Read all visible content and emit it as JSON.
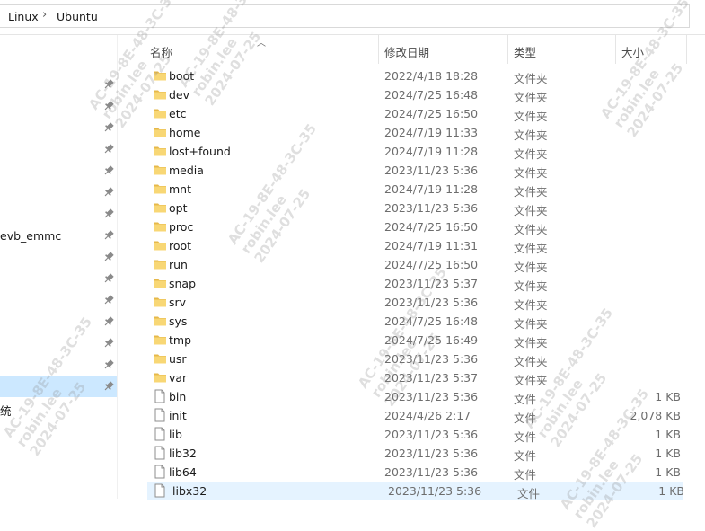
{
  "breadcrumb": {
    "items": [
      "Linux",
      "Ubuntu"
    ],
    "separator": "›"
  },
  "nav": {
    "items": [
      {
        "label": "evb_emmc"
      },
      {
        "label": "统"
      }
    ]
  },
  "columns": {
    "name": "名称",
    "date": "修改日期",
    "type": "类型",
    "size": "大小"
  },
  "files": [
    {
      "name": "boot",
      "date": "2022/4/18 18:28",
      "type": "文件夹",
      "size": "",
      "kind": "folder"
    },
    {
      "name": "dev",
      "date": "2024/7/25 16:48",
      "type": "文件夹",
      "size": "",
      "kind": "folder"
    },
    {
      "name": "etc",
      "date": "2024/7/25 16:50",
      "type": "文件夹",
      "size": "",
      "kind": "folder"
    },
    {
      "name": "home",
      "date": "2024/7/19 11:33",
      "type": "文件夹",
      "size": "",
      "kind": "folder"
    },
    {
      "name": "lost+found",
      "date": "2024/7/19 11:28",
      "type": "文件夹",
      "size": "",
      "kind": "folder"
    },
    {
      "name": "media",
      "date": "2023/11/23 5:36",
      "type": "文件夹",
      "size": "",
      "kind": "folder"
    },
    {
      "name": "mnt",
      "date": "2024/7/19 11:28",
      "type": "文件夹",
      "size": "",
      "kind": "folder"
    },
    {
      "name": "opt",
      "date": "2023/11/23 5:36",
      "type": "文件夹",
      "size": "",
      "kind": "folder"
    },
    {
      "name": "proc",
      "date": "2024/7/25 16:50",
      "type": "文件夹",
      "size": "",
      "kind": "folder"
    },
    {
      "name": "root",
      "date": "2024/7/19 11:31",
      "type": "文件夹",
      "size": "",
      "kind": "folder"
    },
    {
      "name": "run",
      "date": "2024/7/25 16:50",
      "type": "文件夹",
      "size": "",
      "kind": "folder"
    },
    {
      "name": "snap",
      "date": "2023/11/23 5:37",
      "type": "文件夹",
      "size": "",
      "kind": "folder"
    },
    {
      "name": "srv",
      "date": "2023/11/23 5:36",
      "type": "文件夹",
      "size": "",
      "kind": "folder"
    },
    {
      "name": "sys",
      "date": "2024/7/25 16:48",
      "type": "文件夹",
      "size": "",
      "kind": "folder"
    },
    {
      "name": "tmp",
      "date": "2024/7/25 16:49",
      "type": "文件夹",
      "size": "",
      "kind": "folder"
    },
    {
      "name": "usr",
      "date": "2023/11/23 5:36",
      "type": "文件夹",
      "size": "",
      "kind": "folder"
    },
    {
      "name": "var",
      "date": "2023/11/23 5:37",
      "type": "文件夹",
      "size": "",
      "kind": "folder"
    },
    {
      "name": "bin",
      "date": "2023/11/23 5:36",
      "type": "文件",
      "size": "1 KB",
      "kind": "file"
    },
    {
      "name": "init",
      "date": "2024/4/26 2:17",
      "type": "文件",
      "size": "2,078 KB",
      "kind": "file"
    },
    {
      "name": "lib",
      "date": "2023/11/23 5:36",
      "type": "文件",
      "size": "1 KB",
      "kind": "file"
    },
    {
      "name": "lib32",
      "date": "2023/11/23 5:36",
      "type": "文件",
      "size": "1 KB",
      "kind": "file"
    },
    {
      "name": "lib64",
      "date": "2023/11/23 5:36",
      "type": "文件",
      "size": "1 KB",
      "kind": "file"
    },
    {
      "name": "libx32",
      "date": "2023/11/23 5:36",
      "type": "文件",
      "size": "1 KB",
      "kind": "file",
      "selected": true
    }
  ],
  "watermark": {
    "lines": [
      "AC-19-8E-48-3C-35",
      "robin.lee",
      "2024-07-25"
    ]
  },
  "colors": {
    "folder": "#f8d775",
    "folder_dark": "#e6b84a",
    "selected_row": "#e5f3ff",
    "nav_selected": "#cce8ff"
  }
}
